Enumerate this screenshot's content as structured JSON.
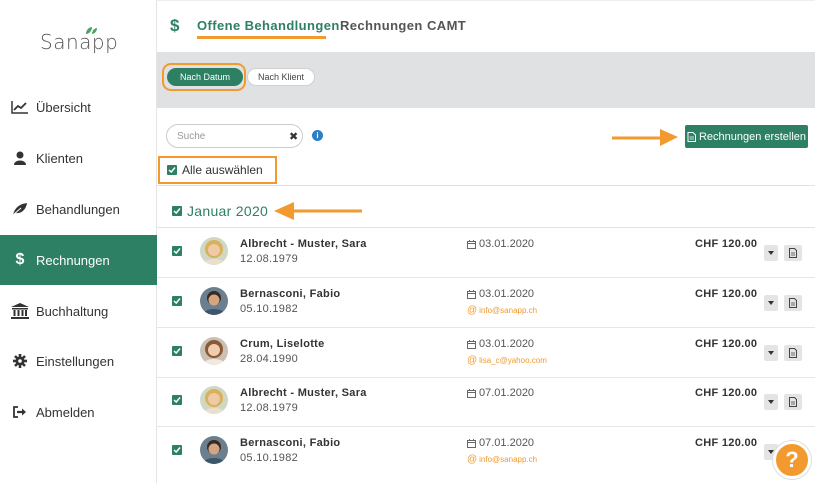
{
  "app": {
    "logo": "Sanapp"
  },
  "sidebar": {
    "items": [
      {
        "label": "Übersicht",
        "icon": "chart-line-icon"
      },
      {
        "label": "Klienten",
        "icon": "user-icon"
      },
      {
        "label": "Behandlungen",
        "icon": "leaf-icon"
      },
      {
        "label": "Rechnungen",
        "icon": "dollar-icon",
        "active": true
      },
      {
        "label": "Buchhaltung",
        "icon": "bank-icon"
      },
      {
        "label": "Einstellungen",
        "icon": "gear-icon"
      },
      {
        "label": "Abmelden",
        "icon": "sign-out-icon"
      }
    ]
  },
  "header": {
    "icon": "$",
    "tabs": [
      {
        "label": "Offene Behandlungen",
        "active": true
      },
      {
        "label": "Rechnungen"
      },
      {
        "label": "CAMT"
      }
    ]
  },
  "filters": {
    "by_date": "Nach Datum",
    "by_client": "Nach Klient"
  },
  "toolbar": {
    "search_placeholder": "Suche",
    "clear": "✖",
    "info": "i",
    "create_button": "Rechnungen erstellen",
    "select_all": "Alle auswählen"
  },
  "group": {
    "month": "Januar 2020"
  },
  "rows": [
    {
      "name": "Albrecht - Muster, Sara",
      "dob": "12.08.1979",
      "date": "03.01.2020",
      "email": "",
      "amount": "CHF 120.00",
      "avatar": "female-blonde"
    },
    {
      "name": "Bernasconi, Fabio",
      "dob": "05.10.1982",
      "date": "03.01.2020",
      "email": "info@sanapp.ch",
      "amount": "CHF 120.00",
      "avatar": "male"
    },
    {
      "name": "Crum, Liselotte",
      "dob": "28.04.1990",
      "date": "03.01.2020",
      "email": "lisa_c@yahoo.com",
      "amount": "CHF 120.00",
      "avatar": "female-brown"
    },
    {
      "name": "Albrecht - Muster, Sara",
      "dob": "12.08.1979",
      "date": "07.01.2020",
      "email": "",
      "amount": "CHF 120.00",
      "avatar": "female-blonde"
    },
    {
      "name": "Bernasconi, Fabio",
      "dob": "05.10.1982",
      "date": "07.01.2020",
      "email": "info@sanapp.ch",
      "amount": "CHF 120.00",
      "avatar": "male"
    }
  ],
  "help": {
    "label": "?"
  },
  "colors": {
    "primary": "#2d8063",
    "accent": "#f29a2e",
    "filter_bg": "#dfe1e3"
  }
}
